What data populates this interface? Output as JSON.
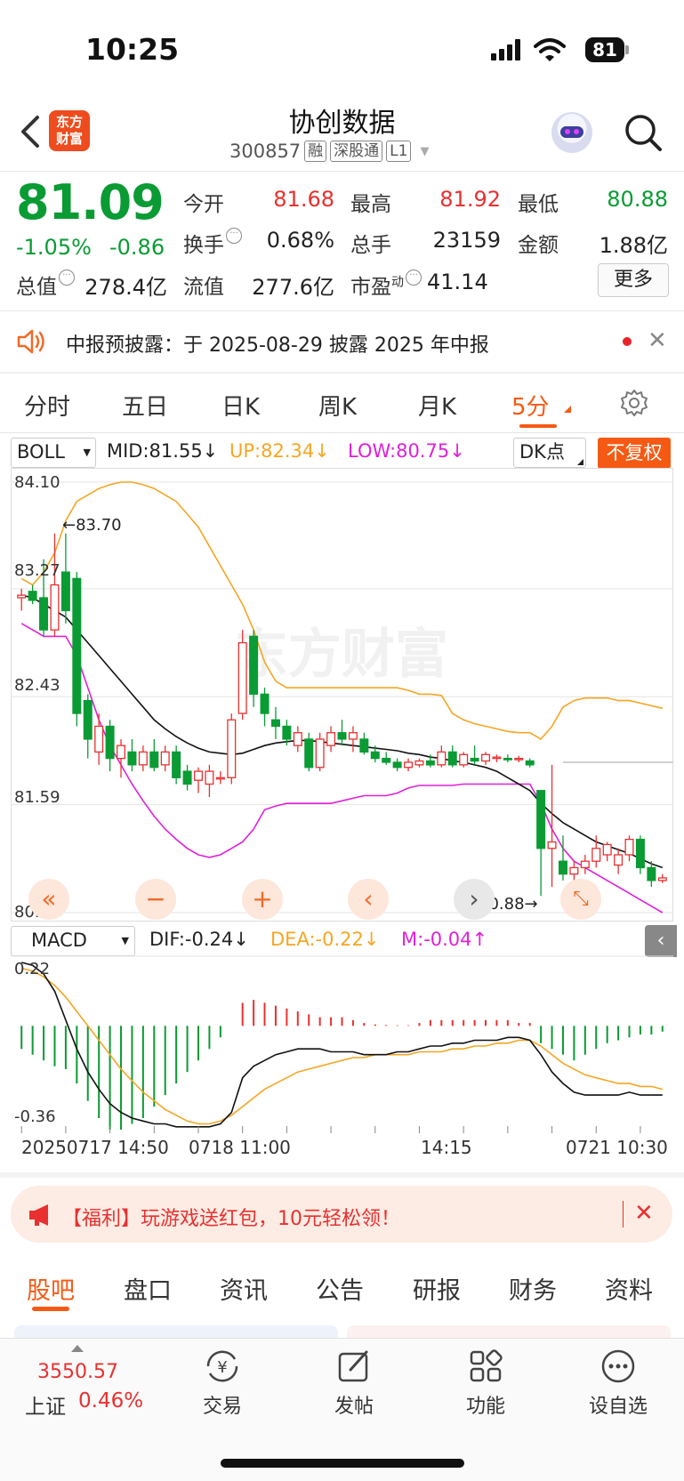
{
  "status_bar": {
    "time": "10:25",
    "battery": "81"
  },
  "header": {
    "app_logo": "东方财富",
    "title": "协创数据",
    "code": "300857",
    "tags": [
      "融",
      "深股通",
      "L1"
    ]
  },
  "quote": {
    "price": "81.09",
    "change_pct": "-1.05%",
    "change": "-0.86",
    "open_label": "今开",
    "open": "81.68",
    "high_label": "最高",
    "high": "81.92",
    "low_label": "最低",
    "low": "80.88",
    "turnover_label": "换手",
    "turnover": "0.68%",
    "volume_label": "总手",
    "volume": "23159",
    "amount_label": "金额",
    "amount": "1.88亿",
    "total_cap_label": "总值",
    "total_cap": "278.4亿",
    "float_cap_label": "流值",
    "float_cap": "277.6亿",
    "pe_label": "市盈",
    "pe_superscript": "动",
    "pe": "41.14",
    "more_label": "更多"
  },
  "notice": {
    "text": "中报预披露：于 2025-08-29 披露 2025 年中报"
  },
  "period_tabs": [
    "分时",
    "五日",
    "日K",
    "周K",
    "月K",
    "5分"
  ],
  "active_period": "5分",
  "indicator": {
    "main_select": "BOLL",
    "mid": "MID:81.55↓",
    "up": "UP:82.34↓",
    "low": "LOW:80.75↓",
    "dk_select": "DK点",
    "adjust_label": "不复权"
  },
  "chart_y_labels": [
    "84.10",
    "83.27",
    "82.43",
    "81.59",
    "80.75"
  ],
  "chart_annotations": {
    "high_marker": "83.70",
    "low_marker": "80.88"
  },
  "macd": {
    "select": "MACD",
    "dif": "DIF:-0.24↓",
    "dea": "DEA:-0.22↓",
    "m": "M:-0.04↑",
    "y_labels": [
      "0.22",
      "-0.36"
    ]
  },
  "time_labels": [
    "20250717 14:50",
    "0718 11:00",
    "14:15",
    "0721 10:30"
  ],
  "promo": {
    "text": "【福利】玩游戏送红包，10元轻松领！"
  },
  "section_tabs": [
    "股吧",
    "盘口",
    "资讯",
    "公告",
    "研报",
    "财务",
    "资料"
  ],
  "bottom_bar": {
    "index_value": "3550.57",
    "index_name": "上证",
    "index_change": "0.46%",
    "nav": [
      "交易",
      "发帖",
      "功能",
      "设自选"
    ]
  },
  "colors": {
    "up": "#e93030",
    "down": "#0a9b34",
    "accent": "#f55a14",
    "mid_line": "#111111",
    "upper_band": "#f5a623",
    "lower_band": "#e020d8"
  },
  "chart_data": {
    "type": "candlestick",
    "ylim": [
      80.75,
      84.1
    ],
    "candles": [
      {
        "o": 83.2,
        "h": 83.27,
        "l": 83.1,
        "c": 83.22
      },
      {
        "o": 83.25,
        "h": 83.3,
        "l": 83.15,
        "c": 83.18
      },
      {
        "o": 83.2,
        "h": 83.5,
        "l": 82.9,
        "c": 82.95
      },
      {
        "o": 82.95,
        "h": 83.7,
        "l": 82.9,
        "c": 83.3
      },
      {
        "o": 83.4,
        "h": 83.7,
        "l": 83.0,
        "c": 83.1
      },
      {
        "o": 83.35,
        "h": 83.4,
        "l": 82.2,
        "c": 82.3
      },
      {
        "o": 82.4,
        "h": 82.45,
        "l": 81.95,
        "c": 82.1
      },
      {
        "o": 82.0,
        "h": 82.3,
        "l": 81.9,
        "c": 82.2
      },
      {
        "o": 82.2,
        "h": 82.25,
        "l": 81.85,
        "c": 81.95
      },
      {
        "o": 81.95,
        "h": 82.1,
        "l": 81.8,
        "c": 82.05
      },
      {
        "o": 82.0,
        "h": 82.1,
        "l": 81.85,
        "c": 81.9
      },
      {
        "o": 81.9,
        "h": 82.05,
        "l": 81.85,
        "c": 82.0
      },
      {
        "o": 82.0,
        "h": 82.1,
        "l": 81.85,
        "c": 81.88
      },
      {
        "o": 81.9,
        "h": 82.05,
        "l": 81.85,
        "c": 82.0
      },
      {
        "o": 82.0,
        "h": 82.05,
        "l": 81.75,
        "c": 81.8
      },
      {
        "o": 81.85,
        "h": 81.9,
        "l": 81.7,
        "c": 81.75
      },
      {
        "o": 81.78,
        "h": 81.88,
        "l": 81.68,
        "c": 81.85
      },
      {
        "o": 81.75,
        "h": 81.9,
        "l": 81.65,
        "c": 81.85
      },
      {
        "o": 81.8,
        "h": 81.85,
        "l": 81.75,
        "c": 81.8
      },
      {
        "o": 81.8,
        "h": 82.3,
        "l": 81.75,
        "c": 82.25
      },
      {
        "o": 82.3,
        "h": 82.95,
        "l": 82.25,
        "c": 82.85
      },
      {
        "o": 82.9,
        "h": 82.95,
        "l": 82.35,
        "c": 82.45
      },
      {
        "o": 82.45,
        "h": 82.5,
        "l": 82.2,
        "c": 82.3
      },
      {
        "o": 82.25,
        "h": 82.35,
        "l": 82.1,
        "c": 82.2
      },
      {
        "o": 82.2,
        "h": 82.25,
        "l": 82.05,
        "c": 82.1
      },
      {
        "o": 82.05,
        "h": 82.2,
        "l": 82.0,
        "c": 82.15
      },
      {
        "o": 82.1,
        "h": 82.15,
        "l": 81.85,
        "c": 81.88
      },
      {
        "o": 81.88,
        "h": 82.15,
        "l": 81.85,
        "c": 82.1
      },
      {
        "o": 82.05,
        "h": 82.2,
        "l": 82.0,
        "c": 82.15
      },
      {
        "o": 82.15,
        "h": 82.25,
        "l": 82.05,
        "c": 82.1
      },
      {
        "o": 82.1,
        "h": 82.2,
        "l": 82.0,
        "c": 82.15
      },
      {
        "o": 82.1,
        "h": 82.15,
        "l": 81.98,
        "c": 82.0
      },
      {
        "o": 82.0,
        "h": 82.05,
        "l": 81.92,
        "c": 81.95
      },
      {
        "o": 81.95,
        "h": 82.0,
        "l": 81.9,
        "c": 81.92
      },
      {
        "o": 81.92,
        "h": 81.95,
        "l": 81.85,
        "c": 81.88
      },
      {
        "o": 81.88,
        "h": 81.95,
        "l": 81.85,
        "c": 81.92
      },
      {
        "o": 81.9,
        "h": 81.95,
        "l": 81.88,
        "c": 81.93
      },
      {
        "o": 81.93,
        "h": 81.98,
        "l": 81.88,
        "c": 81.9
      },
      {
        "o": 81.9,
        "h": 82.05,
        "l": 81.88,
        "c": 82.0
      },
      {
        "o": 82.0,
        "h": 82.05,
        "l": 81.88,
        "c": 81.9
      },
      {
        "o": 81.9,
        "h": 82.0,
        "l": 81.88,
        "c": 81.98
      },
      {
        "o": 81.95,
        "h": 82.05,
        "l": 81.9,
        "c": 81.93
      },
      {
        "o": 81.93,
        "h": 82.0,
        "l": 81.9,
        "c": 81.98
      },
      {
        "o": 81.95,
        "h": 81.98,
        "l": 81.92,
        "c": 81.96
      },
      {
        "o": 81.95,
        "h": 81.98,
        "l": 81.92,
        "c": 81.94
      },
      {
        "o": 81.94,
        "h": 81.97,
        "l": 81.92,
        "c": 81.95
      },
      {
        "o": 81.93,
        "h": 81.95,
        "l": 81.88,
        "c": 81.9
      },
      {
        "o": 81.7,
        "h": 81.7,
        "l": 80.88,
        "c": 81.25
      },
      {
        "o": 81.25,
        "h": 81.9,
        "l": 80.95,
        "c": 81.3
      },
      {
        "o": 81.15,
        "h": 81.35,
        "l": 81.0,
        "c": 81.05
      },
      {
        "o": 81.05,
        "h": 81.15,
        "l": 81.0,
        "c": 81.1
      },
      {
        "o": 81.1,
        "h": 81.2,
        "l": 81.05,
        "c": 81.15
      },
      {
        "o": 81.15,
        "h": 81.35,
        "l": 81.1,
        "c": 81.25
      },
      {
        "o": 81.2,
        "h": 81.3,
        "l": 81.15,
        "c": 81.28
      },
      {
        "o": 81.12,
        "h": 81.25,
        "l": 81.05,
        "c": 81.2
      },
      {
        "o": 81.2,
        "h": 81.35,
        "l": 81.15,
        "c": 81.32
      },
      {
        "o": 81.32,
        "h": 81.35,
        "l": 81.05,
        "c": 81.1
      },
      {
        "o": 81.1,
        "h": 81.15,
        "l": 80.95,
        "c": 81.0
      },
      {
        "o": 81.0,
        "h": 81.05,
        "l": 80.98,
        "c": 81.02
      }
    ],
    "mid_line": [
      83.22,
      83.2,
      83.15,
      83.1,
      83.05,
      82.95,
      82.85,
      82.75,
      82.65,
      82.55,
      82.45,
      82.35,
      82.25,
      82.18,
      82.12,
      82.07,
      82.03,
      82.0,
      81.99,
      81.98,
      81.99,
      82.02,
      82.05,
      82.07,
      82.08,
      82.09,
      82.09,
      82.08,
      82.07,
      82.06,
      82.05,
      82.04,
      82.03,
      82.02,
      82.01,
      81.99,
      81.98,
      81.96,
      81.95,
      81.93,
      81.92,
      81.9,
      81.88,
      81.85,
      81.8,
      81.75,
      81.7,
      81.6,
      81.52,
      81.45,
      81.4,
      81.35,
      81.3,
      81.27,
      81.24,
      81.21,
      81.17,
      81.13,
      81.1
    ],
    "upper_band": [
      83.35,
      83.3,
      83.4,
      83.55,
      83.8,
      83.95,
      84.0,
      84.05,
      84.08,
      84.1,
      84.1,
      84.08,
      84.05,
      84.0,
      83.95,
      83.85,
      83.75,
      83.6,
      83.45,
      83.3,
      83.15,
      82.95,
      82.7,
      82.55,
      82.5,
      82.5,
      82.5,
      82.5,
      82.5,
      82.5,
      82.5,
      82.5,
      82.5,
      82.5,
      82.5,
      82.48,
      82.45,
      82.45,
      82.44,
      82.3,
      82.25,
      82.22,
      82.2,
      82.18,
      82.16,
      82.15,
      82.15,
      82.1,
      82.2,
      82.35,
      82.4,
      82.42,
      82.42,
      82.42,
      82.4,
      82.4,
      82.38,
      82.36,
      82.34
    ],
    "lower_band": [
      83.0,
      82.95,
      82.9,
      82.9,
      82.9,
      82.75,
      82.5,
      82.25,
      82.05,
      81.9,
      81.75,
      81.62,
      81.5,
      81.4,
      81.32,
      81.25,
      81.2,
      81.18,
      81.2,
      81.25,
      81.3,
      81.4,
      81.55,
      81.58,
      81.6,
      81.6,
      81.6,
      81.6,
      81.6,
      81.62,
      81.64,
      81.66,
      81.66,
      81.66,
      81.68,
      81.72,
      81.74,
      81.74,
      81.74,
      81.74,
      81.75,
      81.75,
      81.75,
      81.75,
      81.75,
      81.75,
      81.75,
      81.6,
      81.4,
      81.25,
      81.15,
      81.1,
      81.05,
      81.0,
      80.95,
      80.9,
      80.85,
      80.8,
      80.75
    ],
    "macd_ylim": [
      -0.36,
      0.22
    ],
    "macd_m": [
      -0.08,
      -0.1,
      -0.12,
      -0.14,
      -0.15,
      -0.2,
      -0.26,
      -0.32,
      -0.36,
      -0.36,
      -0.34,
      -0.32,
      -0.28,
      -0.24,
      -0.2,
      -0.16,
      -0.12,
      -0.08,
      -0.04,
      0.0,
      0.08,
      0.09,
      0.08,
      0.07,
      0.06,
      0.05,
      0.04,
      0.03,
      0.03,
      0.03,
      0.02,
      0.01,
      0.005,
      0.003,
      0.002,
      0.002,
      0.01,
      0.02,
      0.02,
      0.02,
      0.02,
      0.02,
      0.02,
      0.02,
      0.02,
      0.01,
      0.01,
      -0.06,
      -0.08,
      -0.1,
      -0.12,
      -0.1,
      -0.08,
      -0.06,
      -0.05,
      -0.04,
      -0.03,
      -0.03,
      -0.02
    ],
    "macd_dif": [
      0.22,
      0.21,
      0.18,
      0.12,
      0.02,
      -0.08,
      -0.16,
      -0.22,
      -0.27,
      -0.3,
      -0.32,
      -0.33,
      -0.34,
      -0.34,
      -0.35,
      -0.35,
      -0.35,
      -0.35,
      -0.34,
      -0.3,
      -0.18,
      -0.14,
      -0.12,
      -0.1,
      -0.09,
      -0.08,
      -0.08,
      -0.08,
      -0.09,
      -0.09,
      -0.09,
      -0.1,
      -0.1,
      -0.1,
      -0.09,
      -0.09,
      -0.08,
      -0.07,
      -0.07,
      -0.06,
      -0.06,
      -0.05,
      -0.05,
      -0.05,
      -0.04,
      -0.04,
      -0.05,
      -0.1,
      -0.16,
      -0.2,
      -0.23,
      -0.24,
      -0.24,
      -0.24,
      -0.24,
      -0.23,
      -0.24,
      -0.24,
      -0.24
    ],
    "macd_dea": [
      0.2,
      0.19,
      0.17,
      0.14,
      0.1,
      0.05,
      0.0,
      -0.05,
      -0.1,
      -0.15,
      -0.19,
      -0.23,
      -0.26,
      -0.29,
      -0.31,
      -0.33,
      -0.34,
      -0.34,
      -0.33,
      -0.31,
      -0.28,
      -0.25,
      -0.22,
      -0.2,
      -0.18,
      -0.16,
      -0.15,
      -0.14,
      -0.13,
      -0.12,
      -0.11,
      -0.11,
      -0.1,
      -0.1,
      -0.1,
      -0.1,
      -0.09,
      -0.09,
      -0.09,
      -0.08,
      -0.08,
      -0.07,
      -0.07,
      -0.06,
      -0.06,
      -0.05,
      -0.05,
      -0.07,
      -0.1,
      -0.13,
      -0.15,
      -0.17,
      -0.18,
      -0.19,
      -0.2,
      -0.2,
      -0.21,
      -0.21,
      -0.22
    ]
  }
}
